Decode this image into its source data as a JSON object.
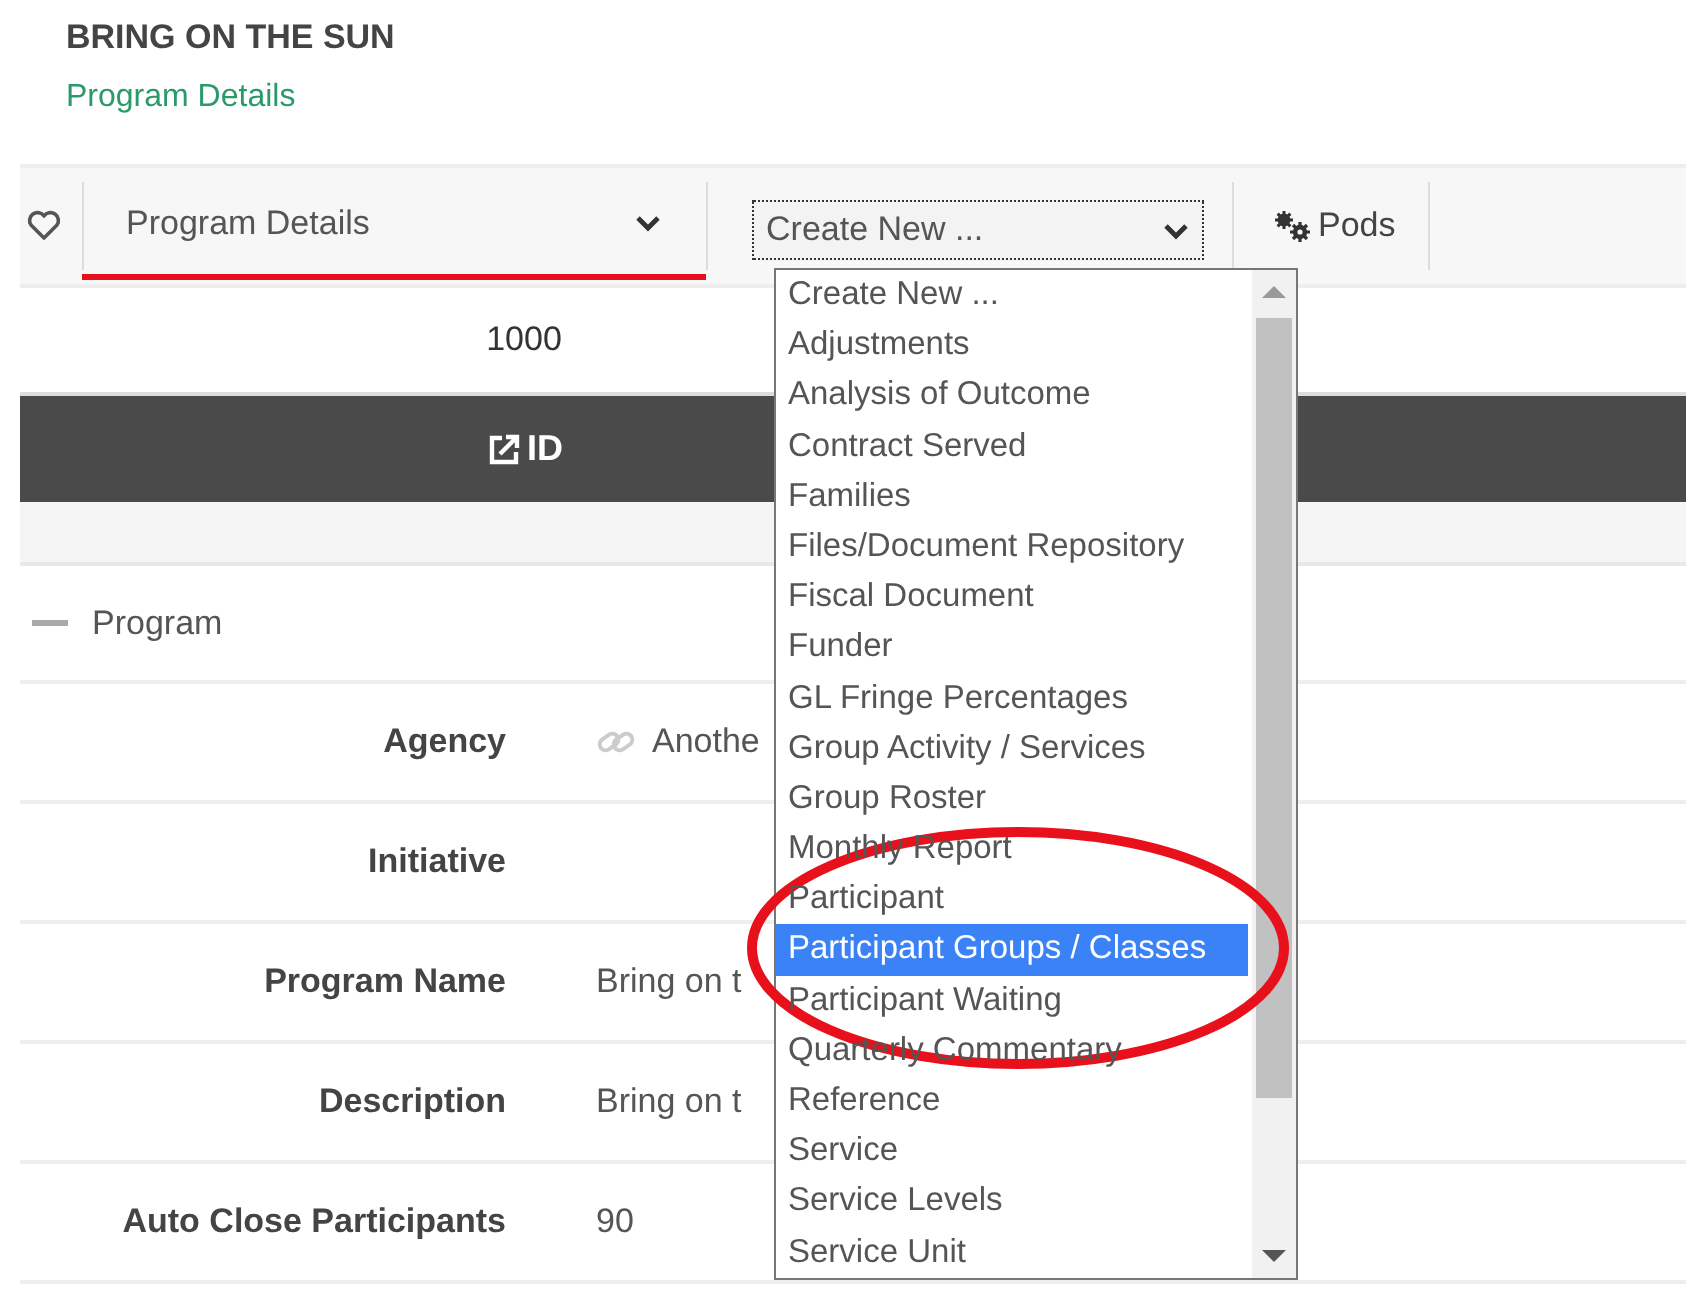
{
  "header": {
    "title": "BRING ON THE SUN",
    "subtitle": "Program Details"
  },
  "toolbar": {
    "favorite": false,
    "view_select": {
      "value": "Program Details",
      "active": true
    },
    "create_select": {
      "value": "Create New ...",
      "open": true
    },
    "pods_button": "Pods"
  },
  "id_value": "1000",
  "id_bar": {
    "label": "ID"
  },
  "section": {
    "title": "Program",
    "expanded": true
  },
  "fields": [
    {
      "label": "Agency",
      "value": "Anothe",
      "linked": true
    },
    {
      "label": "Initiative"
    },
    {
      "label": "Program Name",
      "value": "Bring on t"
    },
    {
      "label": "Description",
      "value": "Bring on t"
    },
    {
      "label": "Auto Close Participants",
      "value": "90"
    }
  ],
  "dropdown_options": [
    {
      "label": "Create New ...",
      "selected": false
    },
    {
      "label": "Adjustments",
      "selected": false
    },
    {
      "label": "Analysis of Outcome",
      "selected": false
    },
    {
      "label": "Contract Served",
      "selected": false
    },
    {
      "label": "Families",
      "selected": false
    },
    {
      "label": "Files/Document Repository",
      "selected": false
    },
    {
      "label": "Fiscal Document",
      "selected": false
    },
    {
      "label": "Funder",
      "selected": false
    },
    {
      "label": "GL Fringe Percentages",
      "selected": false
    },
    {
      "label": "Group Activity / Services",
      "selected": false
    },
    {
      "label": "Group Roster",
      "selected": false
    },
    {
      "label": "Monthly Report",
      "selected": false
    },
    {
      "label": "Participant",
      "selected": false
    },
    {
      "label": "Participant Groups / Classes",
      "selected": true
    },
    {
      "label": "Participant Waiting",
      "selected": false
    },
    {
      "label": "Quarterly Commentary",
      "selected": false
    },
    {
      "label": "Reference",
      "selected": false
    },
    {
      "label": "Service",
      "selected": false
    },
    {
      "label": "Service Levels",
      "selected": false
    },
    {
      "label": "Service Unit",
      "selected": false
    }
  ]
}
